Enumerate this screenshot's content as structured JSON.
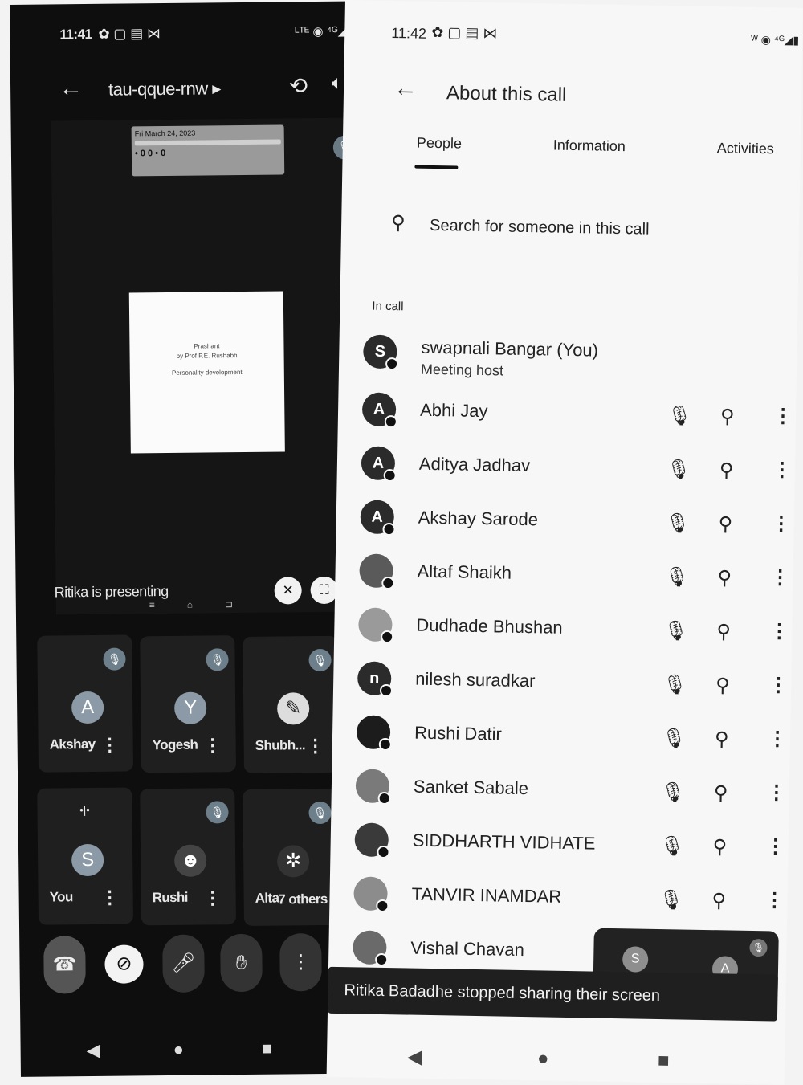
{
  "left": {
    "status_time": "11:41",
    "status_icons_left": "✿ ▢ ▤ ⋈",
    "status_icons_right": "ᴸᵀᴱ ◉ ⁴ᴳ◢▮",
    "call_name": "tau-qque-rnw",
    "thumb_date": "Fri March 24, 2023",
    "thumb_text": "",
    "thumb_number": "• 0 0 • 0",
    "doc_lines": [
      "Prashant",
      "by Prof P.E. Rushabh",
      "Personality development"
    ],
    "presenting_label": "Ritika is presenting",
    "tiles": [
      {
        "name": "Akshay",
        "initial": "A"
      },
      {
        "name": "Yogesh",
        "initial": "Y"
      },
      {
        "name": "Shubh...",
        "initial": ""
      },
      {
        "name": "You",
        "initial": "S"
      },
      {
        "name": "Rushi",
        "initial": ""
      },
      {
        "name": "Alta",
        "initial": "",
        "extra": "7 others"
      }
    ],
    "more_glyph": "⋮",
    "nav": [
      "◀",
      "●",
      "■"
    ]
  },
  "right": {
    "status_time": "11:42",
    "status_icons_left": "✿ ▢ ▤ ⋈",
    "status_icons_right": "ᵂ ◉ ⁴ᴳ◢▮",
    "title": "About this call",
    "tabs": [
      "People",
      "Information",
      "Activities"
    ],
    "search_placeholder": "Search for someone in this call",
    "section_label": "In call",
    "host": {
      "name": "swapnali Bangar (You)",
      "role": "Meeting host",
      "initial": "S"
    },
    "people": [
      {
        "name": "Abhi Jay",
        "initial": "A"
      },
      {
        "name": "Aditya Jadhav",
        "initial": "A"
      },
      {
        "name": "Akshay Sarode",
        "initial": "A"
      },
      {
        "name": "Altaf Shaikh",
        "initial": ""
      },
      {
        "name": "Dudhade Bhushan",
        "initial": ""
      },
      {
        "name": "nilesh suradkar",
        "initial": "n"
      },
      {
        "name": "Rushi Datir",
        "initial": ""
      },
      {
        "name": "Sanket Sabale",
        "initial": ""
      },
      {
        "name": "SIDDHARTH VIDHATE",
        "initial": ""
      },
      {
        "name": "TANVIR INAMDAR",
        "initial": ""
      },
      {
        "name": "Vishal Chavan",
        "initial": ""
      }
    ],
    "pip_initials": [
      "S",
      "A"
    ],
    "toast": "Ritika Badadhe stopped sharing their screen",
    "nav": [
      "◀",
      "●",
      "■"
    ]
  }
}
